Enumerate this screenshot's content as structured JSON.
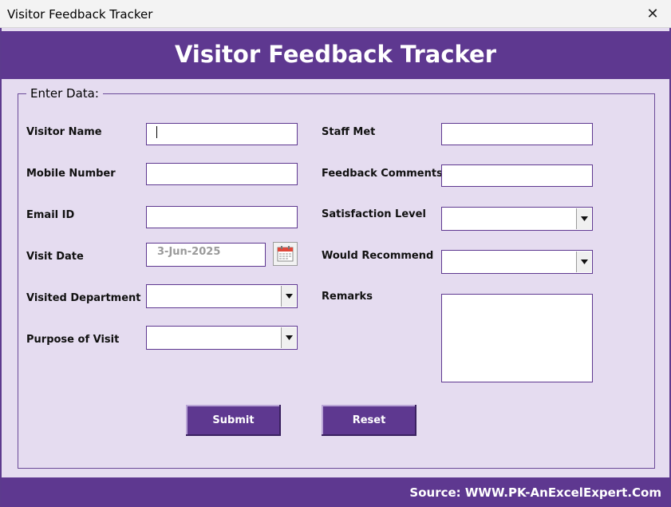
{
  "window": {
    "title": "Visitor Feedback Tracker",
    "close_glyph": "✕"
  },
  "header": {
    "title": "Visitor Feedback Tracker"
  },
  "form": {
    "legend": "Enter Data:",
    "labels": {
      "visitor_name": "Visitor Name",
      "mobile_number": "Mobile Number",
      "email_id": "Email ID",
      "visit_date": "Visit Date",
      "visited_department": "Visited Department",
      "purpose_of_visit": "Purpose of Visit",
      "staff_met": "Staff Met",
      "feedback_comments": "Feedback Comments",
      "satisfaction_level": "Satisfaction Level",
      "would_recommend": "Would Recommend",
      "remarks": "Remarks"
    },
    "values": {
      "visitor_name": "",
      "mobile_number": "",
      "email_id": "",
      "visit_date": "3-Jun-2025",
      "visited_department": "",
      "purpose_of_visit": "",
      "staff_met": "",
      "feedback_comments": "",
      "satisfaction_level": "",
      "would_recommend": "",
      "remarks": ""
    },
    "buttons": {
      "submit": "Submit",
      "reset": "Reset"
    }
  },
  "footer": {
    "source": "Source: WWW.PK-AnExcelExpert.Com"
  },
  "colors": {
    "accent": "#5e3890",
    "form_bg": "#e5dcf0"
  }
}
